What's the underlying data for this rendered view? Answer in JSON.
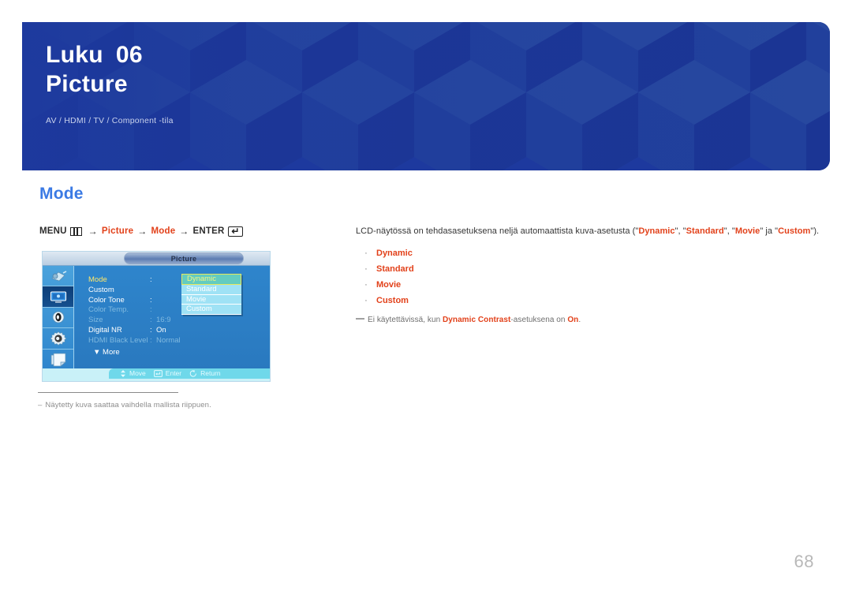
{
  "banner": {
    "chapter_label": "Luku",
    "chapter_number": "06",
    "title": "Picture",
    "subtitle": "AV / HDMI / TV / Component -tila",
    "bg_color": "#1d399e"
  },
  "section": {
    "title": "Mode",
    "title_color": "#3b7ae4"
  },
  "menu_path": {
    "menu_label": "MENU",
    "menu_icon": "menu-grid-icon",
    "arrow": "→",
    "step1": "Picture",
    "step2": "Mode",
    "enter_label": "ENTER",
    "enter_icon": "enter-key-icon",
    "enter_glyph": "↵",
    "accent_color": "#e2411a"
  },
  "osd": {
    "window_title": "Picture",
    "sidebar_icons": [
      {
        "name": "input-source-icon",
        "active": false
      },
      {
        "name": "picture-settings-icon",
        "active": true
      },
      {
        "name": "sound-speaker-icon",
        "active": false
      },
      {
        "name": "setup-gear-icon",
        "active": false
      },
      {
        "name": "multi-control-icon",
        "active": false
      }
    ],
    "rows": [
      {
        "label": "Mode",
        "value": "",
        "state": "highlight"
      },
      {
        "label": "Custom",
        "value": "",
        "state": "normal"
      },
      {
        "label": "Color Tone",
        "value": "",
        "state": "normal"
      },
      {
        "label": "Color Temp.",
        "value": "",
        "state": "dim"
      },
      {
        "label": "Size",
        "value": "16:9",
        "state": "dim"
      },
      {
        "label": "Digital NR",
        "value": "On",
        "state": "normal"
      },
      {
        "label": "HDMI Black Level",
        "value": "Normal",
        "state": "dim"
      }
    ],
    "more_label": "More",
    "more_arrow": "▼",
    "dropdown": [
      {
        "label": "Dynamic",
        "selected": true
      },
      {
        "label": "Standard",
        "selected": false
      },
      {
        "label": "Movie",
        "selected": false
      },
      {
        "label": "Custom",
        "selected": false
      }
    ],
    "footer": [
      {
        "icon": "move-dpad-icon",
        "label": "Move"
      },
      {
        "icon": "enter-key-icon",
        "label": "Enter"
      },
      {
        "icon": "return-arrow-icon",
        "label": "Return"
      }
    ],
    "colors": {
      "body": "#2e85cc",
      "selected_item": "#63ccc0",
      "dropdown_item": "#9fe2f5",
      "footer_bar": "#6fd8ea"
    }
  },
  "left_note": {
    "dash": "–",
    "text": "Näytetty kuva saattaa vaihdella mallista riippuen."
  },
  "right": {
    "intro_parts": [
      {
        "text": "LCD-näytössä on tehdasasetuksena neljä automaattista kuva-asetusta (\"",
        "bold": false
      },
      {
        "text": "Dynamic",
        "bold": true
      },
      {
        "text": "\", \"",
        "bold": false
      },
      {
        "text": "Standard",
        "bold": true
      },
      {
        "text": "\", \"",
        "bold": false
      },
      {
        "text": "Movie",
        "bold": true
      },
      {
        "text": "\" ja \"",
        "bold": false
      },
      {
        "text": "Custom",
        "bold": true
      },
      {
        "text": "\").",
        "bold": false
      }
    ],
    "bullet_marker": "·",
    "bullets": [
      "Dynamic",
      "Standard",
      "Movie",
      "Custom"
    ],
    "footnote_parts": [
      {
        "text": "Ei käytettävissä, kun ",
        "bold": false
      },
      {
        "text": "Dynamic Contrast",
        "bold": true
      },
      {
        "text": "-asetuksena on ",
        "bold": false
      },
      {
        "text": "On",
        "bold": true
      },
      {
        "text": ".",
        "bold": false
      }
    ]
  },
  "page_number": "68"
}
